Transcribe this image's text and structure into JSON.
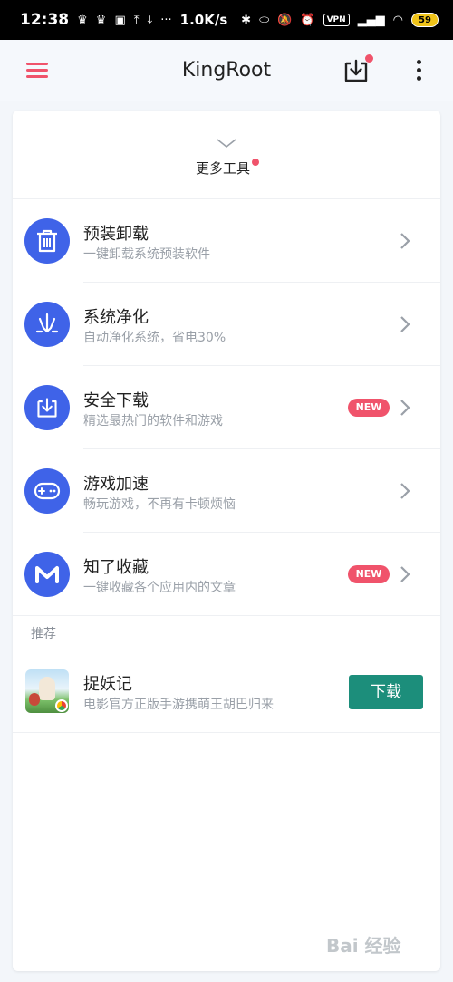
{
  "status_bar": {
    "time": "12:38",
    "dots": "···",
    "speed": "1.0K/s",
    "vpn": "VPN",
    "battery": "59"
  },
  "app_bar": {
    "title": "KingRoot"
  },
  "more_tools": {
    "label": "更多工具"
  },
  "tools": [
    {
      "title": "预装卸载",
      "subtitle": "一键卸载系统预装软件",
      "icon": "trash-icon",
      "badge": ""
    },
    {
      "title": "系统净化",
      "subtitle": "自动净化系统，省电30%",
      "icon": "trident-icon",
      "badge": ""
    },
    {
      "title": "安全下载",
      "subtitle": "精选最热门的软件和游戏",
      "icon": "download-box-icon",
      "badge": "NEW"
    },
    {
      "title": "游戏加速",
      "subtitle": "畅玩游戏，不再有卡顿烦恼",
      "icon": "gamepad-icon",
      "badge": ""
    },
    {
      "title": "知了收藏",
      "subtitle": "一键收藏各个应用内的文章",
      "icon": "m-logo-icon",
      "badge": "NEW"
    }
  ],
  "recommend": {
    "section_label": "推荐",
    "app_name": "捉妖记",
    "app_desc": "电影官方正版手游携萌王胡巴归来",
    "button_label": "下载"
  },
  "watermark": "Bai 经验",
  "colors": {
    "accent_red": "#f0536b",
    "icon_blue": "#3f63e8",
    "download_green": "#1c8e7b"
  }
}
